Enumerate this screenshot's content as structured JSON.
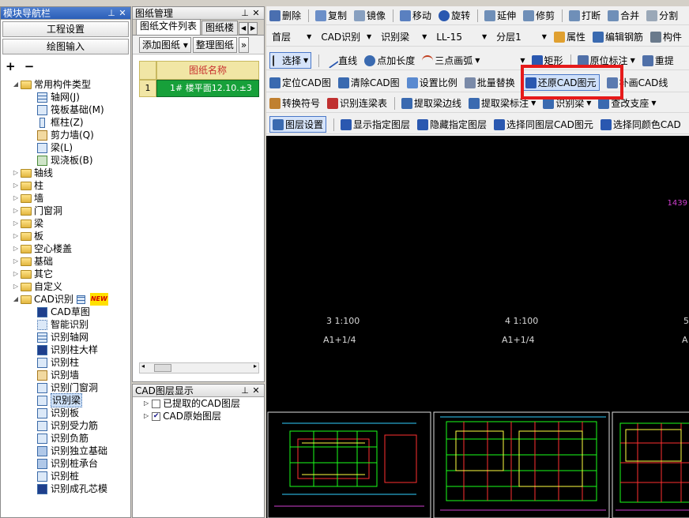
{
  "nav": {
    "title": "模块导航栏",
    "buttons": [
      "工程设置",
      "绘图输入"
    ],
    "tools": "+ −",
    "tree": {
      "common": {
        "label": "常用构件类型",
        "children": [
          "轴网(J)",
          "筏板基础(M)",
          "框柱(Z)",
          "剪力墙(Q)",
          "梁(L)",
          "现浇板(B)"
        ]
      },
      "folders": [
        "轴线",
        "柱",
        "墙",
        "门窗洞",
        "梁",
        "板",
        "空心楼盖",
        "基础",
        "其它",
        "自定义"
      ],
      "cad": {
        "label": "CAD识别",
        "badge": "NEW",
        "children": [
          "CAD草图",
          "智能识别",
          "识别轴网",
          "识别柱大样",
          "识别柱",
          "识别墙",
          "识别门窗洞",
          "识别梁",
          "识别板",
          "识别受力筋",
          "识别负筋",
          "识别独立基础",
          "识别桩承台",
          "识别桩",
          "识别成孔芯模"
        ],
        "selected": "识别梁"
      }
    }
  },
  "drawing_manager": {
    "title": "图纸管理",
    "tabs": [
      "图纸文件列表",
      "图纸楼"
    ],
    "tools": [
      "添加图纸",
      "整理图纸"
    ],
    "grid": {
      "header": "图纸名称",
      "rows": [
        {
          "no": "1",
          "name": "1# 楼平面12.10.±3"
        }
      ]
    }
  },
  "layers": {
    "title": "CAD图层显示",
    "items": [
      {
        "label": "已提取的CAD图层",
        "checked": false
      },
      {
        "label": "CAD原始图层",
        "checked": true
      }
    ]
  },
  "toolbar": {
    "row1": [
      "删除",
      "复制",
      "镜像",
      "移动",
      "旋转",
      "延伸",
      "修剪",
      "打断",
      "合并",
      "分割"
    ],
    "row2": {
      "floor": "首层",
      "mode": "CAD识别",
      "type": "识别梁",
      "component": "LL-15",
      "layer": "分层1",
      "actions": [
        "属性",
        "编辑钢筋",
        "构件"
      ]
    },
    "row3": {
      "select": "选择",
      "items": [
        "直线",
        "点加长度",
        "三点画弧"
      ],
      "rect": "矩形",
      "actions": [
        "原位标注",
        "重提"
      ]
    },
    "row4": [
      "定位CAD图",
      "清除CAD图",
      "设置比例",
      "批量替换",
      "还原CAD图元",
      "补画CAD线"
    ],
    "row5": [
      "转换符号",
      "识别连梁表",
      "提取梁边线",
      "提取梁标注",
      "识别梁",
      "查改支座"
    ],
    "row6": [
      "图层设置",
      "显示指定图层",
      "隐藏指定图层",
      "选择同图层CAD图元",
      "选择同颜色CAD"
    ],
    "highlighted": "还原CAD图元"
  },
  "canvas": {
    "labels": [
      {
        "scale": "3 1:100",
        "ref": "A1+1/4"
      },
      {
        "scale": "4 1:100",
        "ref": "A1+1/4"
      },
      {
        "scale": "5",
        "ref": "A"
      }
    ],
    "magenta": "1439"
  }
}
